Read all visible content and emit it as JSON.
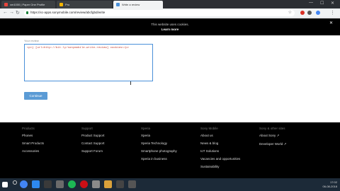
{
  "browser": {
    "tabs": [
      {
        "title": "xm1000 | Paper One Profile",
        "active": false,
        "favicon_color": "#e8453c"
      },
      {
        "title": "Pro",
        "active": false,
        "favicon_color": "#f4b400"
      },
      {
        "title": "Write a review",
        "active": true,
        "favicon_color": "#4a90d9"
      }
    ],
    "url": "https://xc-apps.sonymobile.com/review/abcfgbd/write",
    "minimize": "—",
    "maximize": "☐",
    "close": "✕"
  },
  "cookie_banner": {
    "message": "This website uses cookies.",
    "link": "Learn more",
    "close": "✕"
  },
  "review": {
    "label": "Your review",
    "text": "<p>j [url=http://bit.ly/sonymobile-write-review] cookies</p>",
    "submit": "Continue"
  },
  "footer": {
    "columns": [
      {
        "heading": "Products",
        "links": [
          "Phones",
          "Smart Products",
          "Accessories"
        ]
      },
      {
        "heading": "Support",
        "links": [
          "Product Support",
          "Contact Support",
          "Support Forum"
        ]
      },
      {
        "heading": "Xperia",
        "links": [
          "Xperia",
          "Xperia Technology",
          "Smartphone photography",
          "Xperia in business"
        ]
      },
      {
        "heading": "Sony Mobile",
        "links": [
          "About us",
          "News & blog",
          "IoT Solutions",
          "Vacancies and opportunities",
          "Sustainability"
        ]
      },
      {
        "heading": "Sony & other sites",
        "links": [
          "About Sony ↗",
          "Developer World ↗"
        ]
      }
    ]
  },
  "taskbar": {
    "apps": [
      {
        "name": "start",
        "color": "#ffffff"
      },
      {
        "name": "chrome",
        "color": "#4285f4"
      },
      {
        "name": "explorer",
        "color": "#2d89ef"
      },
      {
        "name": "terminal",
        "color": "#3a3a3a"
      },
      {
        "name": "app",
        "color": "#6b6b6b"
      },
      {
        "name": "spotify",
        "color": "#1db954"
      },
      {
        "name": "opera",
        "color": "#cc0f16"
      },
      {
        "name": "app2",
        "color": "#8a8a8a"
      },
      {
        "name": "app3",
        "color": "#d9a13b"
      },
      {
        "name": "app4",
        "color": "#444444"
      },
      {
        "name": "app5",
        "color": "#555555"
      }
    ],
    "time": "17:02",
    "date": "06-08-2018"
  }
}
